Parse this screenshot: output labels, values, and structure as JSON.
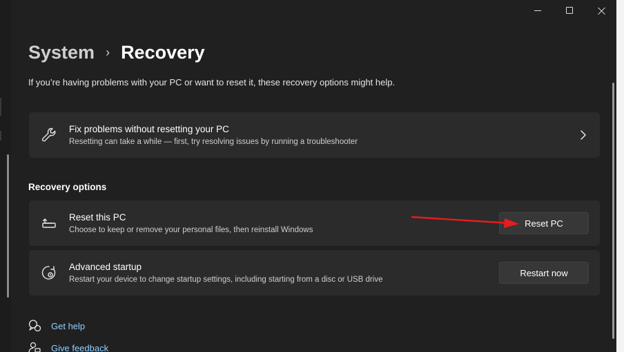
{
  "window": {
    "minimize_icon": "minimize-icon",
    "maximize_icon": "maximize-icon",
    "close_icon": "close-icon"
  },
  "breadcrumb": {
    "parent": "System",
    "separator": "›",
    "current": "Recovery"
  },
  "intro_text": "If you’re having problems with your PC or want to reset it, these recovery options might help.",
  "fix_card": {
    "icon": "wrench-icon",
    "title": "Fix problems without resetting your PC",
    "description": "Resetting can take a while — first, try resolving issues by running a troubleshooter"
  },
  "recovery_options": {
    "heading": "Recovery options",
    "items": [
      {
        "icon": "reset-pc-icon",
        "title": "Reset this PC",
        "description": "Choose to keep or remove your personal files, then reinstall Windows",
        "button_label": "Reset PC"
      },
      {
        "icon": "advanced-startup-icon",
        "title": "Advanced startup",
        "description": "Restart your device to change startup settings, including starting from a disc or USB drive",
        "button_label": "Restart now"
      }
    ]
  },
  "links": [
    {
      "icon": "help-icon",
      "label": "Get help"
    },
    {
      "icon": "feedback-icon",
      "label": "Give feedback"
    }
  ],
  "colors": {
    "background": "#202020",
    "card": "#2b2b2b",
    "link": "#8fd0ff",
    "annotation_arrow": "#e81c1c"
  }
}
